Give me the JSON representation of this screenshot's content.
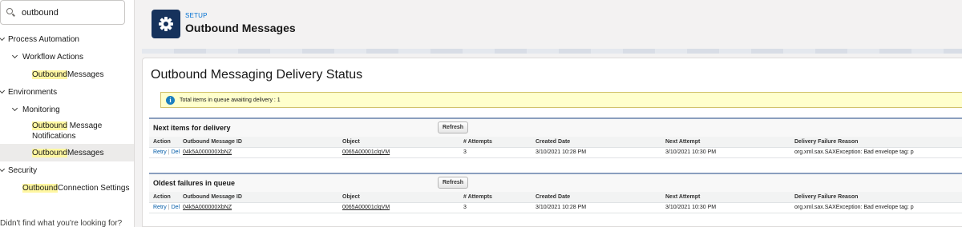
{
  "sidebar": {
    "search_value": "outbound",
    "items": [
      {
        "label": "Process Automation"
      },
      {
        "label": "Workflow Actions"
      },
      {
        "hl": "Outbound",
        "rest": " Messages"
      },
      {
        "label": "Environments"
      },
      {
        "label": "Monitoring"
      },
      {
        "hl": "Outbound",
        "rest": " Message",
        "line2": "Notifications"
      },
      {
        "hl": "Outbound",
        "rest": " Messages"
      },
      {
        "label": "Security"
      },
      {
        "hl": "Outbound",
        "rest": " Connection Settings"
      }
    ],
    "footer": "Didn't find what you're looking for?"
  },
  "header": {
    "eyebrow": "SETUP",
    "title": "Outbound Messages"
  },
  "main": {
    "heading": "Outbound Messaging Delivery Status",
    "info": "Total items in queue awaiting delivery : 1",
    "columns": [
      "Action",
      "Outbound Message ID",
      "Object",
      "# Attempts",
      "Created Date",
      "Next Attempt",
      "Delivery Failure Reason"
    ],
    "refresh_label": "Refresh",
    "retry_label": "Retry",
    "sep": "|",
    "del_label": "Del",
    "sections": [
      {
        "title": "Next items for delivery",
        "rows": [
          {
            "message_id": "04k5A000000XbNZ",
            "object": "0065A00001clqVM",
            "attempts": "3",
            "created": "3/10/2021 10:28 PM",
            "next": "3/10/2021 10:30 PM",
            "reason": "org.xml.sax.SAXException: Bad envelope tag: p"
          }
        ]
      },
      {
        "title": "Oldest failures in queue",
        "rows": [
          {
            "message_id": "04k5A000000XbNZ",
            "object": "0065A00001clqVM",
            "attempts": "3",
            "created": "3/10/2021 10:28 PM",
            "next": "3/10/2021 10:30 PM",
            "reason": "org.xml.sax.SAXException: Bad envelope tag: p"
          }
        ]
      }
    ]
  },
  "colors": {
    "highlight": "#fff7a1",
    "brand_icon": "#16325c",
    "link": "#015ba7",
    "info_bg": "#ffffcc"
  },
  "icons": [
    "search-icon",
    "chevron-down-icon",
    "gear-icon",
    "info-icon"
  ]
}
